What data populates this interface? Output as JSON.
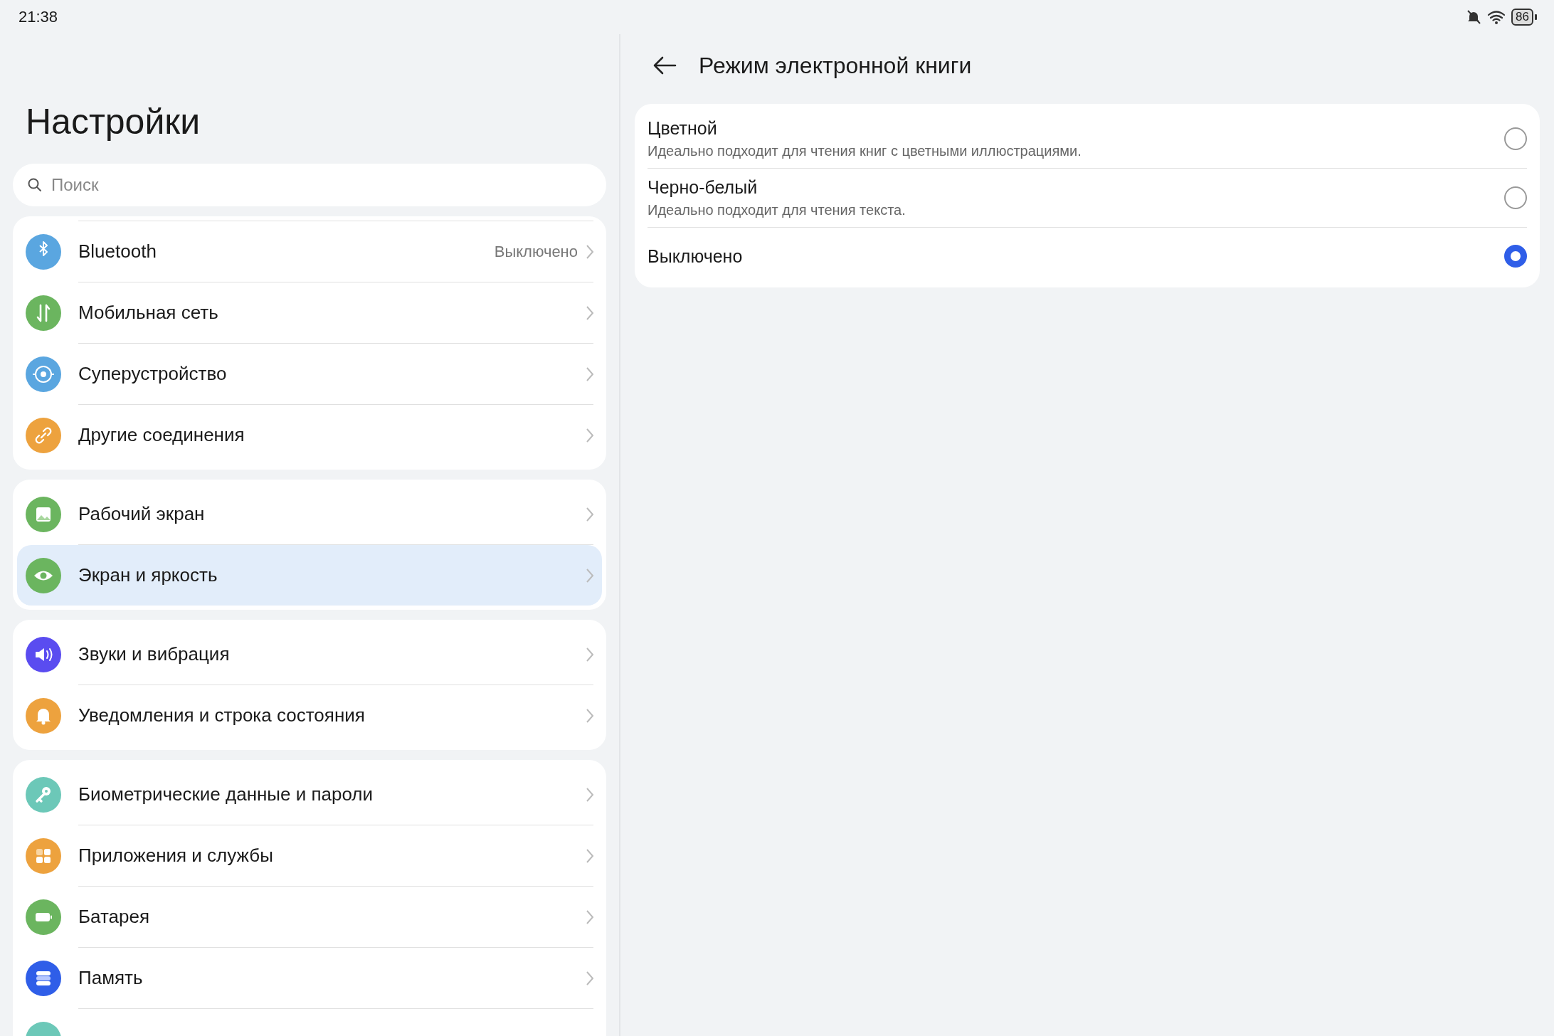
{
  "status_bar": {
    "time": "21:38",
    "battery": "86"
  },
  "sidebar": {
    "title": "Настройки",
    "search": {
      "placeholder": "Поиск"
    },
    "groups": [
      {
        "items": [
          {
            "label": "Bluetooth",
            "value": "Выключено",
            "color": "#5aa6e0",
            "selected": false
          },
          {
            "label": "Мобильная сеть",
            "color": "#6bb55f",
            "selected": false
          },
          {
            "label": "Суперустройство",
            "color": "#5aa6e0",
            "selected": false
          },
          {
            "label": "Другие соединения",
            "color": "#eda23e",
            "selected": false
          }
        ]
      },
      {
        "items": [
          {
            "label": "Рабочий экран",
            "color": "#6bb55f",
            "selected": false
          },
          {
            "label": "Экран и яркость",
            "color": "#6bb55f",
            "selected": true
          }
        ]
      },
      {
        "items": [
          {
            "label": "Звуки и вибрация",
            "color": "#5a4cf0",
            "selected": false
          },
          {
            "label": "Уведомления и строка состояния",
            "color": "#eda23e",
            "selected": false
          }
        ]
      },
      {
        "items": [
          {
            "label": "Биометрические данные и пароли",
            "color": "#6cc8b8",
            "selected": false
          },
          {
            "label": "Приложения и службы",
            "color": "#eda23e",
            "selected": false
          },
          {
            "label": "Батарея",
            "color": "#6bb55f",
            "selected": false
          },
          {
            "label": "Память",
            "color": "#2f5ee8",
            "selected": false
          },
          {
            "color": "#6cc8b8",
            "selected": false
          }
        ]
      }
    ]
  },
  "detail": {
    "title": "Режим электронной книги",
    "options": [
      {
        "label": "Цветной",
        "description": "Идеально подходит для чтения книг с цветными иллюстрациями.",
        "selected": false
      },
      {
        "label": "Черно-белый",
        "description": "Идеально подходит для чтения текста.",
        "selected": false
      },
      {
        "label": "Выключено",
        "selected": true
      }
    ]
  }
}
